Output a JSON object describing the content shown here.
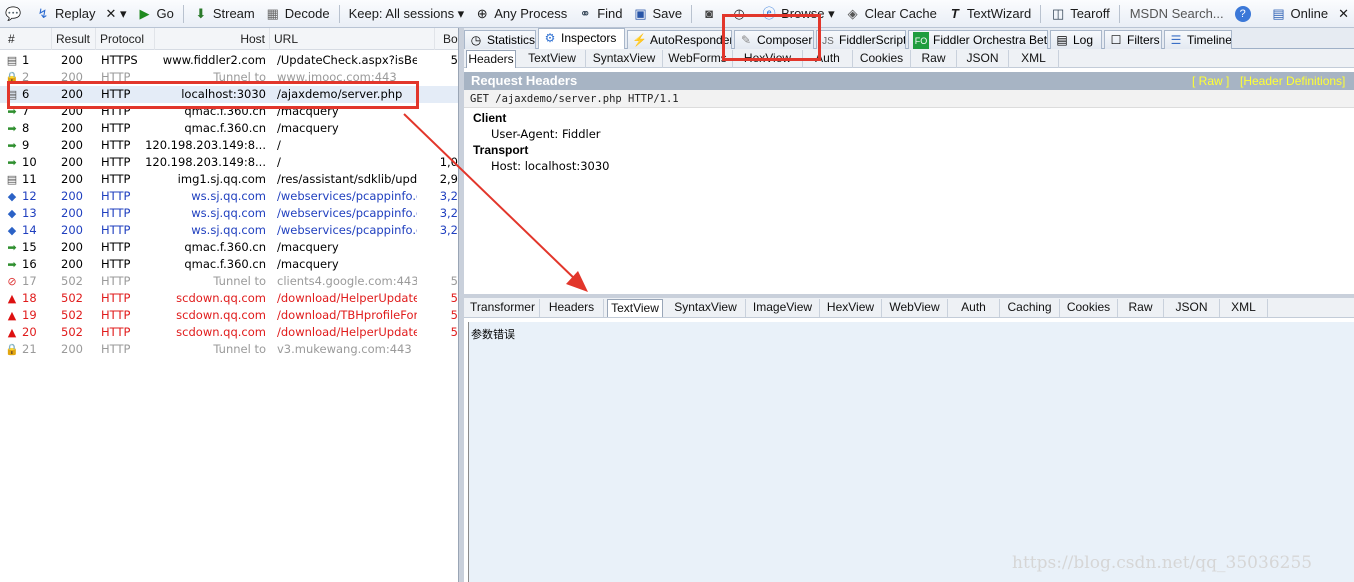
{
  "toolbar": {
    "replay": "Replay",
    "remove": "✕ ▾",
    "go": "Go",
    "stream": "Stream",
    "decode": "Decode",
    "keep": "Keep: All sessions ▾",
    "any_process": "Any Process",
    "find": "Find",
    "save": "Save",
    "browse": "Browse ▾",
    "clear_cache": "Clear Cache",
    "textwizard": "TextWizard",
    "tearoff": "Tearoff",
    "search": "MSDN Search...",
    "online": "Online",
    "close": "✕"
  },
  "sessions": {
    "columns": [
      "#",
      "Result",
      "Protocol",
      "Host",
      "URL",
      "Bo"
    ],
    "rows": [
      {
        "icon": "doc",
        "num": "1",
        "result": "200",
        "protocol": "HTTPS",
        "host": "www.fiddler2.com",
        "url": "/UpdateCheck.aspx?isBet...",
        "body": "5",
        "color": "#000000"
      },
      {
        "icon": "lock",
        "num": "2",
        "result": "200",
        "protocol": "HTTP",
        "host": "Tunnel to",
        "url": "www.imooc.com:443",
        "body": "",
        "color": "#9a9a9a"
      },
      {
        "icon": "doc",
        "num": "6",
        "result": "200",
        "protocol": "HTTP",
        "host": "localhost:3030",
        "url": "/ajaxdemo/server.php",
        "body": "",
        "color": "#000000"
      },
      {
        "icon": "js",
        "num": "7",
        "result": "200",
        "protocol": "HTTP",
        "host": "qmac.f.360.cn",
        "url": "/macquery",
        "body": "",
        "color": "#000000"
      },
      {
        "icon": "js",
        "num": "8",
        "result": "200",
        "protocol": "HTTP",
        "host": "qmac.f.360.cn",
        "url": "/macquery",
        "body": "",
        "color": "#000000"
      },
      {
        "icon": "js",
        "num": "9",
        "result": "200",
        "protocol": "HTTP",
        "host": "120.198.203.149:8...",
        "url": "/",
        "body": "",
        "color": "#000000"
      },
      {
        "icon": "js",
        "num": "10",
        "result": "200",
        "protocol": "HTTP",
        "host": "120.198.203.149:8...",
        "url": "/",
        "body": "1,0",
        "color": "#000000"
      },
      {
        "icon": "doc",
        "num": "11",
        "result": "200",
        "protocol": "HTTP",
        "host": "img1.sj.qq.com",
        "url": "/res/assistant/sdklib/upda...",
        "body": "2,9",
        "color": "#000000"
      },
      {
        "icon": "xml",
        "num": "12",
        "result": "200",
        "protocol": "HTTP",
        "host": "ws.sj.qq.com",
        "url": "/webservices/pcappinfo.d...",
        "body": "3,2",
        "color": "#1f3fbf"
      },
      {
        "icon": "xml",
        "num": "13",
        "result": "200",
        "protocol": "HTTP",
        "host": "ws.sj.qq.com",
        "url": "/webservices/pcappinfo.d...",
        "body": "3,2",
        "color": "#1f3fbf"
      },
      {
        "icon": "xml",
        "num": "14",
        "result": "200",
        "protocol": "HTTP",
        "host": "ws.sj.qq.com",
        "url": "/webservices/pcappinfo.d...",
        "body": "3,2",
        "color": "#1f3fbf"
      },
      {
        "icon": "js",
        "num": "15",
        "result": "200",
        "protocol": "HTTP",
        "host": "qmac.f.360.cn",
        "url": "/macquery",
        "body": "",
        "color": "#000000"
      },
      {
        "icon": "js",
        "num": "16",
        "result": "200",
        "protocol": "HTTP",
        "host": "qmac.f.360.cn",
        "url": "/macquery",
        "body": "",
        "color": "#000000"
      },
      {
        "icon": "blocked",
        "num": "17",
        "result": "502",
        "protocol": "HTTP",
        "host": "Tunnel to",
        "url": "clients4.google.com:443",
        "body": "5",
        "color": "#9a9a9a"
      },
      {
        "icon": "warn",
        "num": "18",
        "result": "502",
        "protocol": "HTTP",
        "host": "scdown.qq.com",
        "url": "/download/HelperUpdate....",
        "body": "5",
        "color": "#e01b1b"
      },
      {
        "icon": "warn",
        "num": "19",
        "result": "502",
        "protocol": "HTTP",
        "host": "scdown.qq.com",
        "url": "/download/TBHprofileFor...",
        "body": "5",
        "color": "#e01b1b"
      },
      {
        "icon": "warn",
        "num": "20",
        "result": "502",
        "protocol": "HTTP",
        "host": "scdown.qq.com",
        "url": "/download/HelperUpdate....",
        "body": "5",
        "color": "#e01b1b"
      },
      {
        "icon": "lock",
        "num": "21",
        "result": "200",
        "protocol": "HTTP",
        "host": "Tunnel to",
        "url": "v3.mukewang.com:443",
        "body": "",
        "color": "#9a9a9a"
      }
    ]
  },
  "main_tabs": [
    "Statistics",
    "Inspectors",
    "AutoResponder",
    "Composer",
    "FiddlerScript",
    "Fiddler Orchestra Beta",
    "Log",
    "Filters",
    "Timeline"
  ],
  "request_tabs": [
    "Headers",
    "TextView",
    "SyntaxView",
    "WebForms",
    "HexView",
    "Auth",
    "Cookies",
    "Raw",
    "JSON",
    "XML"
  ],
  "request": {
    "title": "Request Headers",
    "raw_link": "[ Raw ]",
    "defs_link": "[Header Definitions]",
    "line": "GET /ajaxdemo/server.php HTTP/1.1",
    "groups": [
      {
        "name": "Client",
        "headers": [
          "User-Agent: Fiddler"
        ]
      },
      {
        "name": "Transport",
        "headers": [
          "Host: localhost:3030"
        ]
      }
    ]
  },
  "response_tabs": [
    "Transformer",
    "Headers",
    "TextView",
    "SyntaxView",
    "ImageView",
    "HexView",
    "WebView",
    "Auth",
    "Caching",
    "Cookies",
    "Raw",
    "JSON",
    "XML"
  ],
  "response": {
    "text": "参数错误"
  },
  "watermark": "https://blog.csdn.net/qq_35036255"
}
